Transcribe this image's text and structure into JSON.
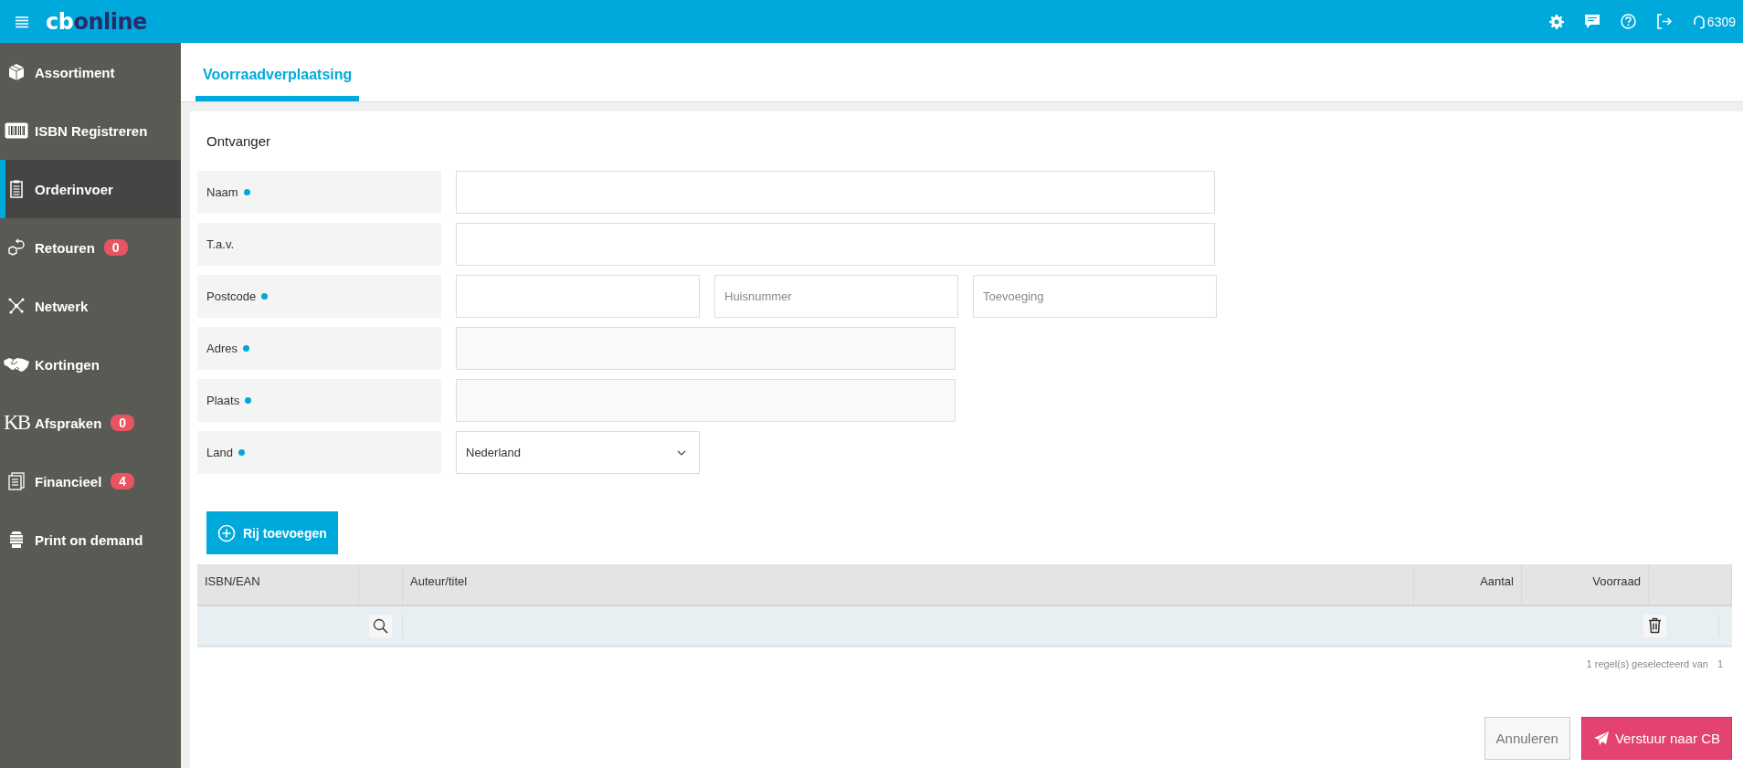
{
  "topbar": {
    "logo": {
      "part_1": "cb",
      "part_2": "online"
    },
    "user_code": "6309"
  },
  "sidebar": {
    "items": [
      {
        "label": "Assortiment",
        "selected": false
      },
      {
        "label": "ISBN Registreren",
        "selected": false
      },
      {
        "label": "Orderinvoer",
        "selected": true
      },
      {
        "label": "Retouren",
        "selected": false,
        "badge": "0"
      },
      {
        "label": "Netwerk",
        "selected": false
      },
      {
        "label": "Kortingen",
        "selected": false
      },
      {
        "label": "Afspraken",
        "selected": false,
        "badge": "0",
        "icon_text": "KB"
      },
      {
        "label": "Financieel",
        "selected": false,
        "badge": "4"
      },
      {
        "label": "Print on demand",
        "selected": false
      }
    ]
  },
  "tabs": [
    {
      "label": "Voorraadverplaatsing",
      "selected": true
    }
  ],
  "form": {
    "section_title": "Ontvanger",
    "fields": [
      {
        "label": "Naam",
        "required": true,
        "kind": "text"
      },
      {
        "label": "T.a.v.",
        "required": false,
        "kind": "text"
      },
      {
        "label": "Postcode",
        "required": true,
        "kind": "parts",
        "placeholders": [
          "Huisnummer",
          "Toevoeging"
        ]
      },
      {
        "label": "Adres",
        "required": true,
        "kind": "readonly"
      },
      {
        "label": "Plaats",
        "required": true,
        "kind": "readonly"
      },
      {
        "label": "Land",
        "required": true,
        "kind": "select",
        "value": "Nederland"
      }
    ]
  },
  "add_row_button": "Rij toevoegen",
  "table": {
    "columns": [
      {
        "kind": "text",
        "label": "ISBN/EAN"
      },
      {
        "kind": "search"
      },
      {
        "kind": "text",
        "label": "Auteur/titel"
      },
      {
        "kind": "number",
        "label": "Aantal"
      },
      {
        "kind": "number",
        "label": "Voorraad"
      },
      {
        "kind": "action"
      }
    ],
    "rows": [
      {
        "selected": true
      }
    ],
    "footer": {
      "text": "1 regel(s) geselecteerd van",
      "total": "1"
    }
  },
  "buttons": [
    {
      "kind": "secondary",
      "label": "Annuleren"
    },
    {
      "kind": "primary",
      "label": "Verstuur naar CB"
    }
  ]
}
